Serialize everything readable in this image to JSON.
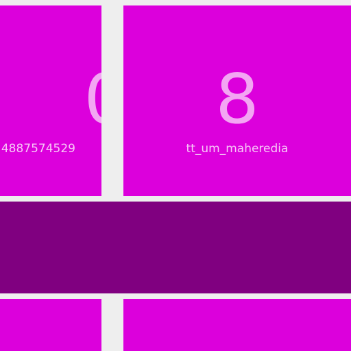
{
  "colors": {
    "tile": "#dc00dc",
    "band": "#800080",
    "background": "#eeeeee",
    "text": "#f7c8f7"
  },
  "tiles": [
    {
      "count": "0",
      "name": "4887574529"
    },
    {
      "count": "8",
      "name": "tt_um_maheredia"
    }
  ]
}
